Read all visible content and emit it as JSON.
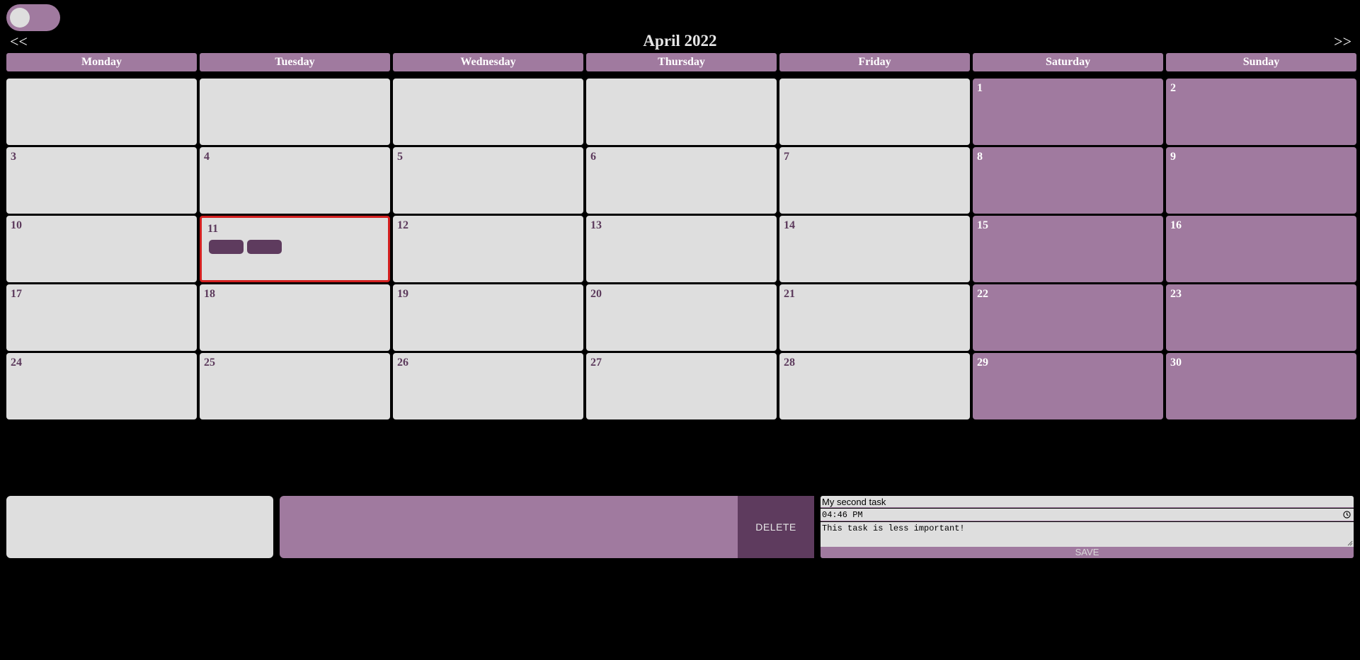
{
  "header": {
    "prev_label": "<<",
    "next_label": ">>",
    "month_title": "April 2022"
  },
  "weekdays": [
    "Monday",
    "Tuesday",
    "Wednesday",
    "Thursday",
    "Friday",
    "Saturday",
    "Sunday"
  ],
  "days": [
    "",
    "",
    "",
    "",
    "",
    "1",
    "2",
    "3",
    "4",
    "5",
    "6",
    "7",
    "8",
    "9",
    "10",
    "11",
    "12",
    "13",
    "14",
    "15",
    "16",
    "17",
    "18",
    "19",
    "20",
    "21",
    "22",
    "23",
    "24",
    "25",
    "26",
    "27",
    "28",
    "29",
    "30"
  ],
  "selected_day": "11",
  "task_counts": {
    "11": 2
  },
  "task_bar": {
    "delete_label": "DELETE"
  },
  "edit_form": {
    "title_value": "My second task",
    "time_value": "04:46 PM",
    "description_value": "This task is less important!",
    "save_label": "SAVE"
  },
  "colors": {
    "background": "#000000",
    "accent": "#a07a9f",
    "accent_dark": "#5e3b5e",
    "cell": "#dedede",
    "selected_border": "#d42020"
  }
}
